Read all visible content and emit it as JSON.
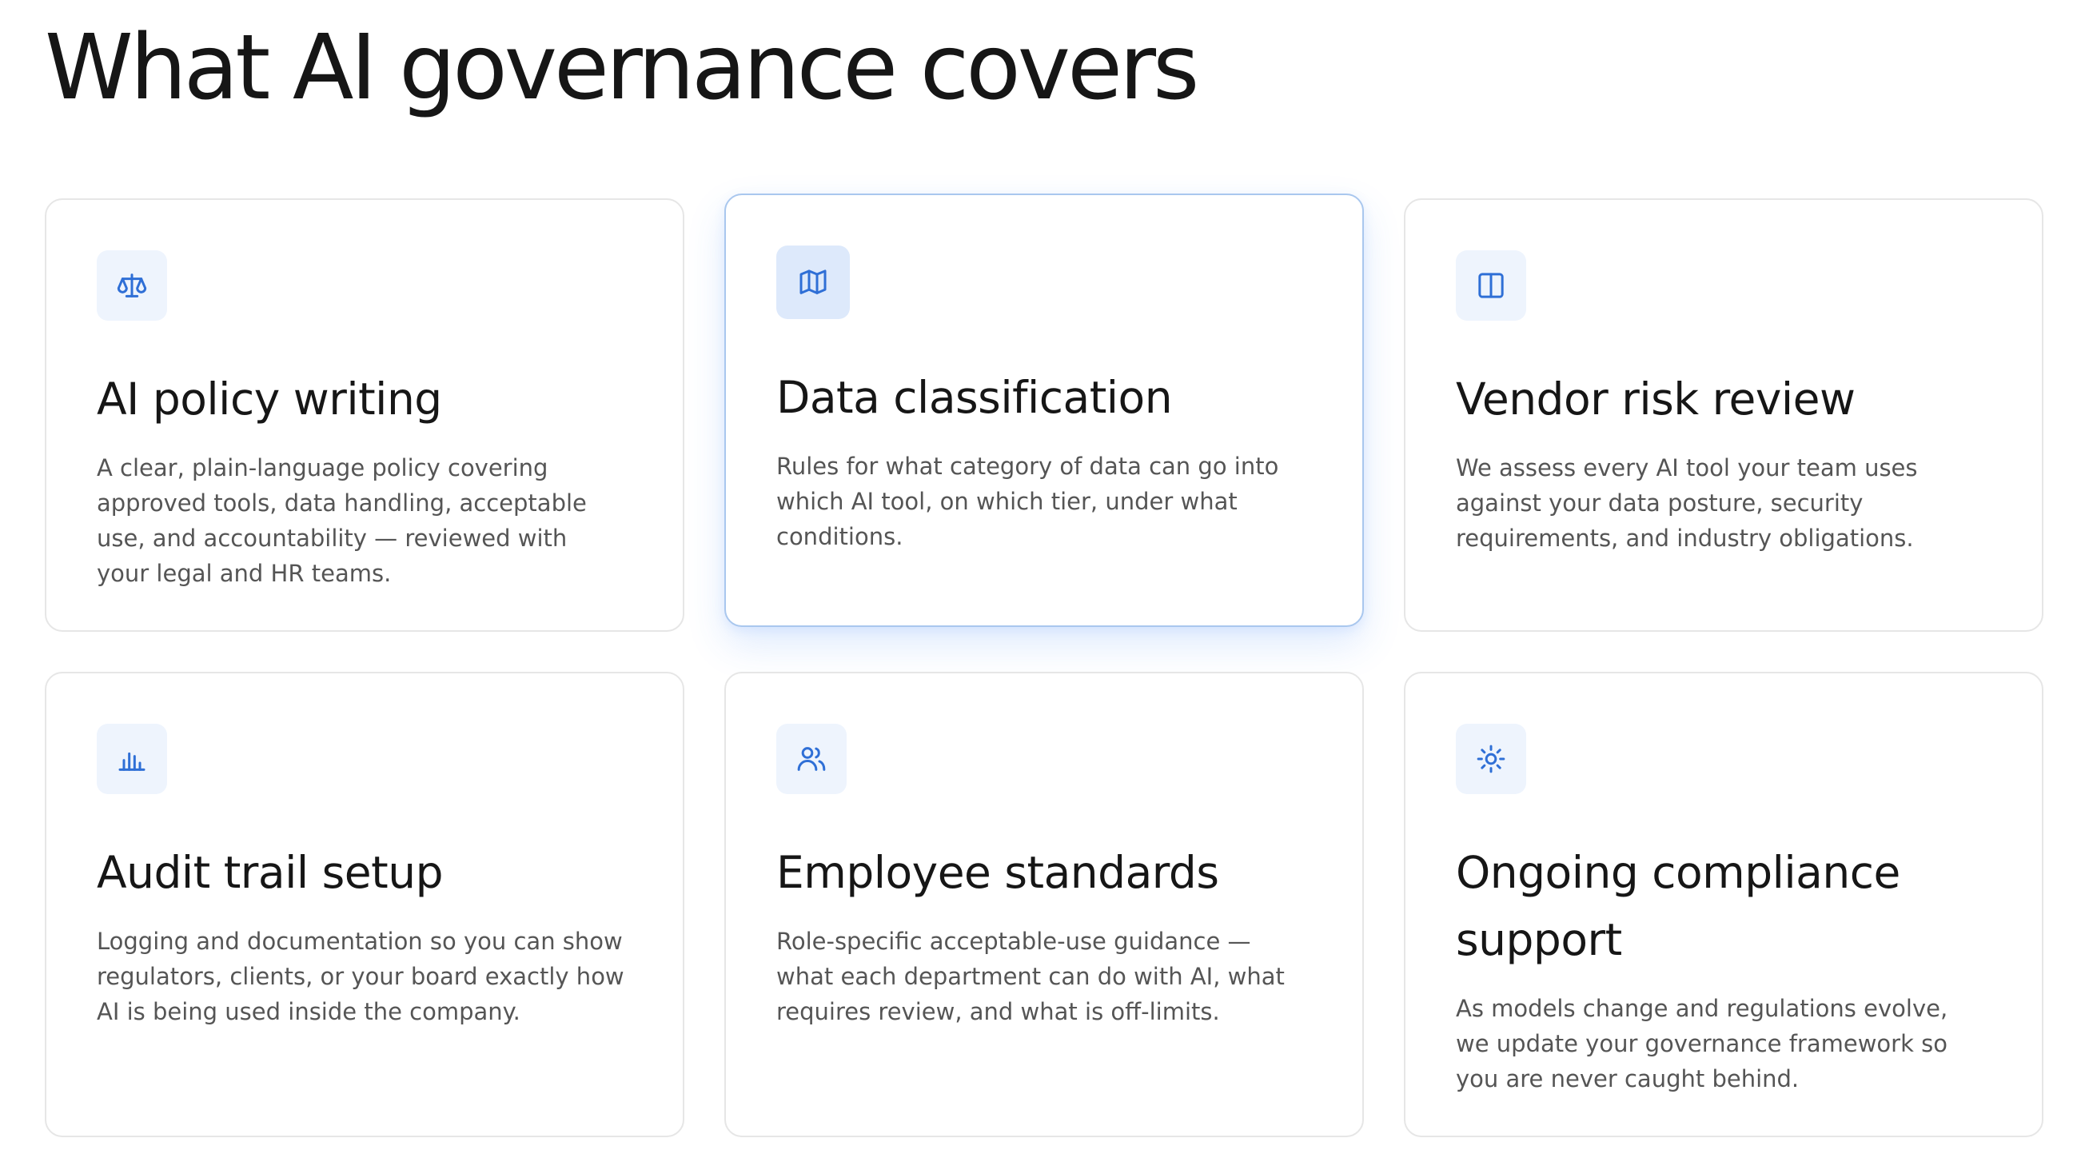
{
  "page_title": "What AI governance covers",
  "accent_color": "#2f6fd6",
  "cards": [
    {
      "icon": "scale-icon",
      "title": "AI policy writing",
      "description": "A clear, plain-language policy covering approved tools, data handling, acceptable use, and accountability — reviewed with your legal and HR teams."
    },
    {
      "icon": "map-icon",
      "title": "Data classification",
      "description": "Rules for what category of data can go into which AI tool, on which tier, under what conditions."
    },
    {
      "icon": "columns-icon",
      "title": "Vendor risk review",
      "description": "We assess every AI tool your team uses against your data posture, security requirements, and industry obligations."
    },
    {
      "icon": "bar-chart-icon",
      "title": "Audit trail setup",
      "description": "Logging and documentation so you can show regulators, clients, or your board exactly how AI is being used inside the company."
    },
    {
      "icon": "users-icon",
      "title": "Employee standards",
      "description": "Role-specific acceptable-use guidance — what each department can do with AI, what requires review, and what is off-limits."
    },
    {
      "icon": "sun-icon",
      "title": "Ongoing compliance support",
      "description": "As models change and regulations evolve, we update your governance framework so you are never caught behind."
    }
  ]
}
